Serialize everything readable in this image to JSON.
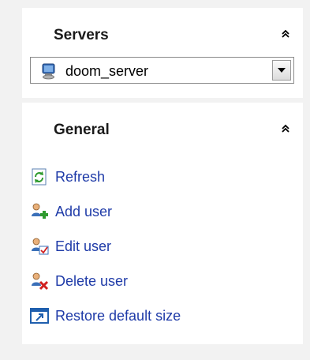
{
  "servers": {
    "title": "Servers",
    "selected_server": "doom_server"
  },
  "general": {
    "title": "General",
    "actions": [
      {
        "label": "Refresh",
        "icon": "refresh-icon"
      },
      {
        "label": "Add user",
        "icon": "add-user-icon"
      },
      {
        "label": "Edit user",
        "icon": "edit-user-icon"
      },
      {
        "label": "Delete user",
        "icon": "delete-user-icon"
      },
      {
        "label": "Restore default size",
        "icon": "restore-size-icon"
      }
    ]
  },
  "colors": {
    "link": "#1f3ba8",
    "background": "#f2f2f2",
    "panel": "#ffffff"
  }
}
